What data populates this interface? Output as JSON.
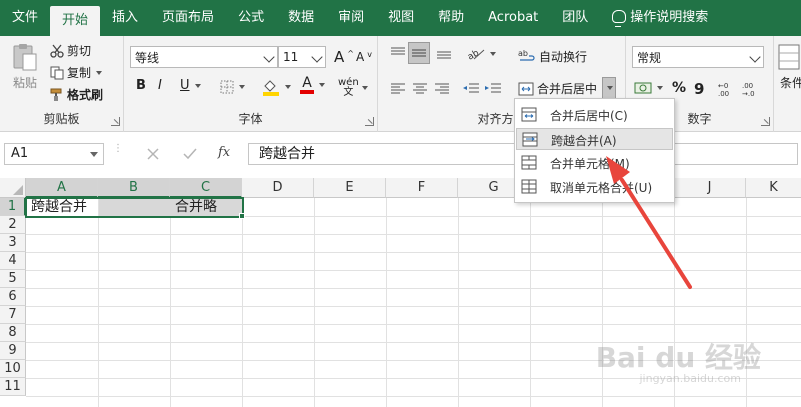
{
  "menubar": {
    "tabs": [
      "文件",
      "开始",
      "插入",
      "页面布局",
      "公式",
      "数据",
      "审阅",
      "视图",
      "帮助",
      "Acrobat",
      "团队"
    ],
    "active_tab": "开始",
    "tell_me": "操作说明搜索"
  },
  "ribbon": {
    "clipboard": {
      "paste": "粘贴",
      "cut": "剪切",
      "copy": "复制",
      "format_painter": "格式刷",
      "label": "剪贴板"
    },
    "font": {
      "font_name": "等线",
      "font_size": "11",
      "grow": "A",
      "shrink": "A",
      "bold": "B",
      "italic": "I",
      "underline": "U",
      "font_color_letter": "A",
      "phonetic": "wén",
      "label": "字体"
    },
    "alignment": {
      "wrap_text": "自动换行",
      "merge_center": "合并后居中",
      "label": "对齐方式"
    },
    "number": {
      "format": "常规",
      "percent": "%",
      "comma": "9",
      "label": "数字"
    },
    "cond": {
      "label_partial": "条件"
    }
  },
  "formula_bar": {
    "name_box": "A1",
    "fx": "fx",
    "formula": "跨越合并"
  },
  "grid": {
    "columns": [
      "A",
      "B",
      "C",
      "D",
      "E",
      "F",
      "G",
      "H",
      "I",
      "J",
      "K"
    ],
    "rows": [
      "1",
      "2",
      "3",
      "4",
      "5",
      "6",
      "7",
      "8",
      "9",
      "10",
      "11"
    ],
    "cells": {
      "A1": "跨越合并",
      "C1": "合并略"
    }
  },
  "merge_menu": {
    "items": [
      {
        "label": "合并后居中(C)"
      },
      {
        "label": "跨越合并(A)"
      },
      {
        "label": "合并单元格(M)"
      },
      {
        "label": "取消单元格合并(U)"
      }
    ],
    "highlighted": 1
  },
  "watermark": {
    "brand": "Bai du 经验",
    "url": "jingyan.baidu.com"
  },
  "colors": {
    "excel_green": "#217346",
    "arrow_red": "#e8453c",
    "ribbon_bg": "#f3f3f3"
  }
}
